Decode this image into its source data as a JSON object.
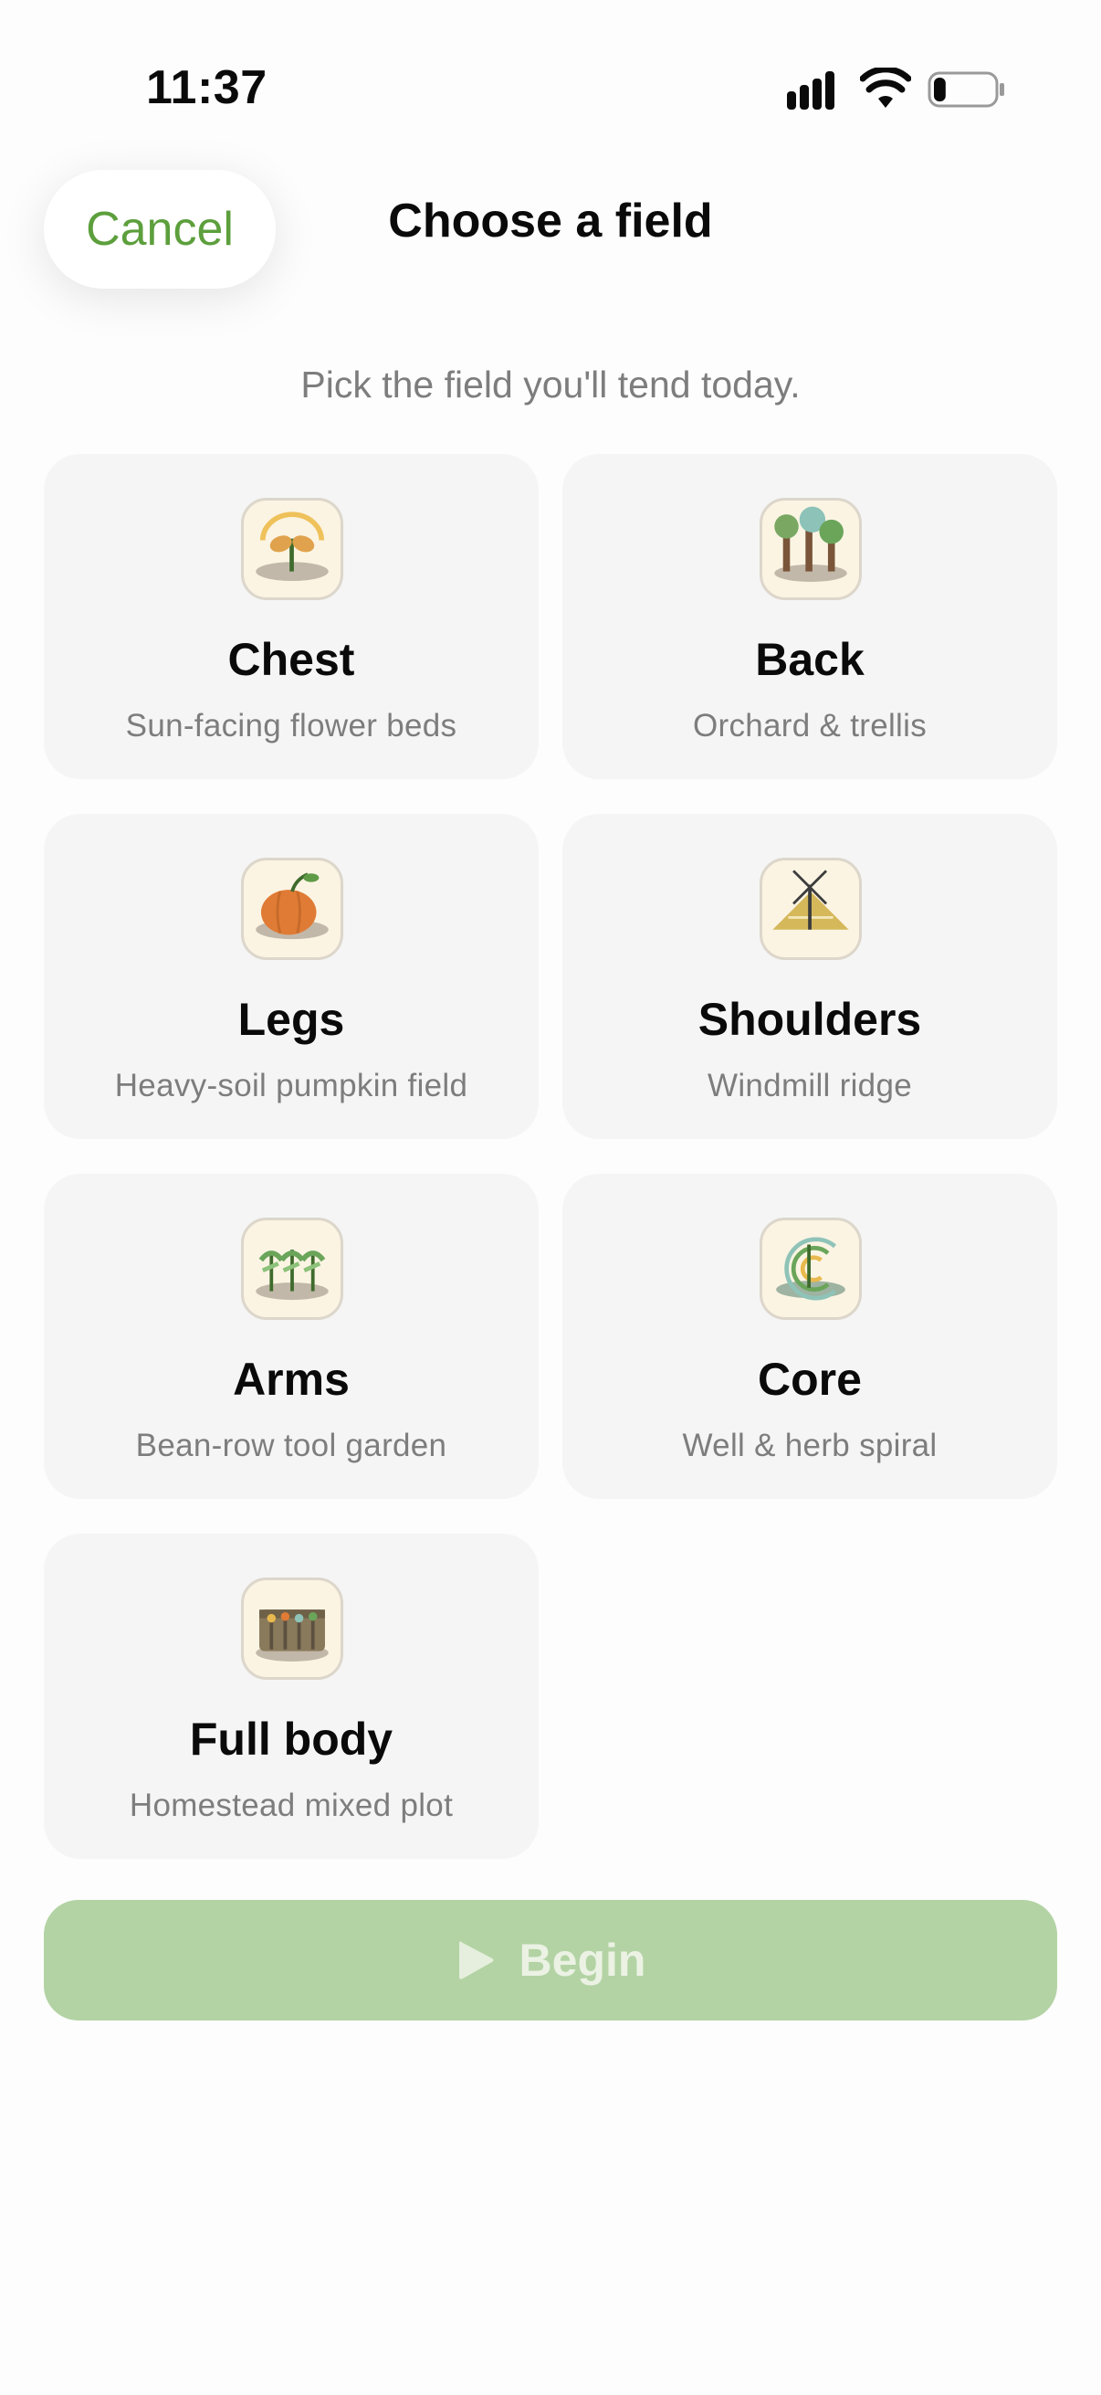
{
  "status_bar": {
    "time": "11:37",
    "icons": [
      "signal-icon",
      "wifi-icon",
      "battery-icon"
    ],
    "battery_level": 0.2
  },
  "header": {
    "cancel_label": "Cancel",
    "title": "Choose a field"
  },
  "subtitle": "Pick the field you'll tend today.",
  "fields": [
    {
      "title": "Chest",
      "description": "Sun-facing flower beds",
      "icon": "sunflower-icon"
    },
    {
      "title": "Back",
      "description": "Orchard & trellis",
      "icon": "orchard-icon"
    },
    {
      "title": "Legs",
      "description": "Heavy-soil pumpkin field",
      "icon": "pumpkin-icon"
    },
    {
      "title": "Shoulders",
      "description": "Windmill ridge",
      "icon": "windmill-icon"
    },
    {
      "title": "Arms",
      "description": "Bean-row tool garden",
      "icon": "bean-rows-icon"
    },
    {
      "title": "Core",
      "description": "Well & herb spiral",
      "icon": "herb-spiral-icon"
    },
    {
      "title": "Full body",
      "description": "Homestead mixed plot",
      "icon": "homestead-icon"
    }
  ],
  "begin_button": {
    "label": "Begin",
    "icon": "play-icon",
    "enabled": false
  },
  "colors": {
    "accent": "#5c9f3c",
    "card_background": "#f5f5f5",
    "begin_disabled": "#b3d3a4",
    "muted_text": "#7d7d7d"
  }
}
